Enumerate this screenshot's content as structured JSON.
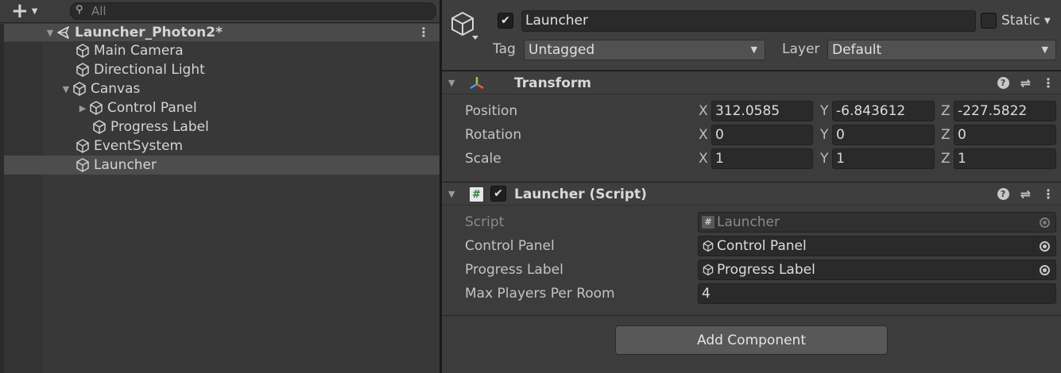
{
  "hierarchy": {
    "add_icon": "plus-icon",
    "search": {
      "placeholder": "All",
      "value": ""
    },
    "items": [
      {
        "label": "Launcher_Photon2*",
        "depth": 0,
        "type": "scene",
        "expanded": true
      },
      {
        "label": "Main Camera",
        "depth": 1,
        "type": "gameobject"
      },
      {
        "label": "Directional Light",
        "depth": 1,
        "type": "gameobject"
      },
      {
        "label": "Canvas",
        "depth": 1,
        "type": "gameobject",
        "expanded": true
      },
      {
        "label": "Control Panel",
        "depth": 2,
        "type": "gameobject",
        "collapsed": true
      },
      {
        "label": "Progress Label",
        "depth": 2,
        "type": "gameobject"
      },
      {
        "label": "EventSystem",
        "depth": 1,
        "type": "gameobject"
      },
      {
        "label": "Launcher",
        "depth": 1,
        "type": "gameobject",
        "selected": true
      }
    ]
  },
  "inspector": {
    "object": {
      "name": "Launcher",
      "active": true,
      "static_label": "Static",
      "static_checked": false,
      "tag_label": "Tag",
      "tag_value": "Untagged",
      "layer_label": "Layer",
      "layer_value": "Default"
    },
    "transform": {
      "title": "Transform",
      "rows": [
        {
          "label": "Position",
          "x": "312.0585",
          "y": "-6.843612",
          "z": "-227.5822"
        },
        {
          "label": "Rotation",
          "x": "0",
          "y": "0",
          "z": "0"
        },
        {
          "label": "Scale",
          "x": "1",
          "y": "1",
          "z": "1"
        }
      ],
      "axes": [
        "X",
        "Y",
        "Z"
      ]
    },
    "script_component": {
      "title": "Launcher (Script)",
      "enabled": true,
      "fields": [
        {
          "label": "Script",
          "value": "Launcher",
          "kind": "script",
          "disabled": true
        },
        {
          "label": "Control Panel",
          "value": "Control Panel",
          "kind": "object"
        },
        {
          "label": "Progress Label",
          "value": "Progress Label",
          "kind": "object"
        },
        {
          "label": "Max Players Per Room",
          "value": "4",
          "kind": "int"
        }
      ]
    },
    "add_component_label": "Add Component"
  },
  "colors": {
    "panel_bg": "#383838",
    "inspector_bg": "#3c3c3c",
    "field_bg": "#2a2a2a",
    "selected_row": "#4d4d4d",
    "text": "#d2d2d2"
  }
}
